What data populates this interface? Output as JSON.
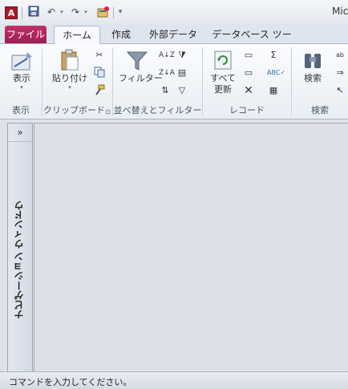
{
  "title_bar": {
    "app_icon_letter": "A",
    "window_title": "Mic"
  },
  "quick_access": {
    "save": "save-icon",
    "undo": "undo-icon",
    "redo": "redo-icon",
    "customize": "customize-qat-icon"
  },
  "tabs": {
    "file": "ファイル",
    "home": "ホーム",
    "create": "作成",
    "external": "外部データ",
    "database_tools": "データベース ツール"
  },
  "ribbon": {
    "views": {
      "view_label": "表示",
      "group_label": "表示"
    },
    "clipboard": {
      "paste_label": "貼り付け",
      "group_label": "クリップボード"
    },
    "sort_filter": {
      "filter_label": "フィルター",
      "group_label": "並べ替えとフィルター"
    },
    "records": {
      "refresh_line1": "すべて",
      "refresh_line2": "更新",
      "group_label": "レコード"
    },
    "find": {
      "find_label": "検索",
      "group_label": "検索"
    }
  },
  "nav_pane": {
    "toggle": "»",
    "label": "ナビゲーション ウィンドウ"
  },
  "status_bar": {
    "text": "コマンドを入力してください。"
  },
  "colors": {
    "file_tab": "#a82058",
    "accent": "#3a6ea5"
  }
}
